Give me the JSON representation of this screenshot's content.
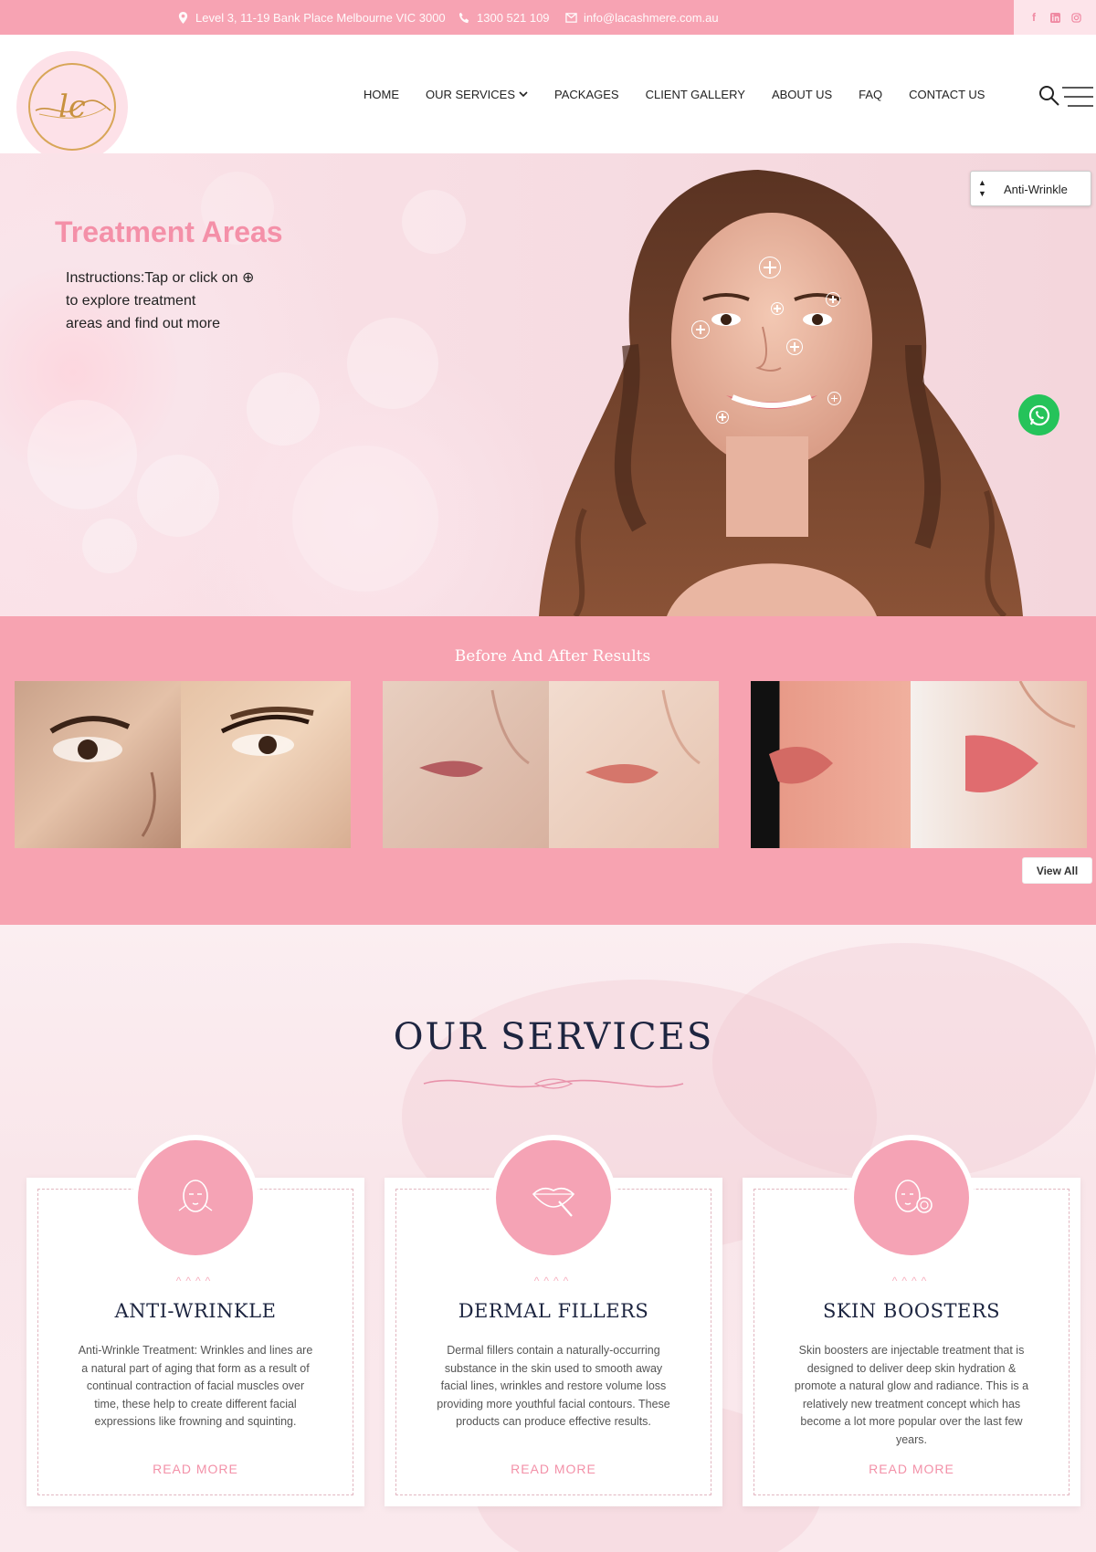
{
  "topbar": {
    "address": "Level 3, 11-19 Bank Place Melbourne VIC 3000",
    "phone": "1300 521 109",
    "email": "info@lacashmere.com.au",
    "social": [
      "facebook-icon",
      "linkedin-icon",
      "instagram-icon"
    ]
  },
  "header": {
    "logo_monogram": "lc",
    "nav": [
      "HOME",
      "OUR SERVICES",
      "PACKAGES",
      "CLIENT GALLERY",
      "ABOUT US",
      "FAQ",
      "CONTACT US"
    ]
  },
  "hero": {
    "title": "Treatment Areas",
    "instructions": [
      "Instructions:Tap or click on ⊕",
      "to explore treatment",
      "areas and find out more"
    ],
    "select_value": "Anti-Wrinkle"
  },
  "before_after": {
    "title": "Before And After Results",
    "view_all": "View All"
  },
  "services": {
    "title": "OUR SERVICES",
    "cards": [
      {
        "title": "ANTI-WRINKLE",
        "text": "Anti-Wrinkle Treatment: Wrinkles and lines are a natural part of aging that form as a result of continual contraction of facial muscles over time, these help to create different facial expressions like frowning and squinting.",
        "read_more": "READ MORE",
        "icon": "face-icon"
      },
      {
        "title": "DERMAL FILLERS",
        "text": "Dermal fillers contain a naturally-occurring substance in the skin used to smooth away facial lines, wrinkles and restore volume loss providing more youthful facial contours. These products can produce effective results.",
        "read_more": "READ MORE",
        "icon": "lips-syringe-icon"
      },
      {
        "title": "SKIN BOOSTERS",
        "text": "Skin boosters are injectable treatment that is designed to deliver deep skin hydration & promote a natural glow and radiance. This is a relatively new treatment concept which has become a lot more popular over the last few years.",
        "read_more": "READ MORE",
        "icon": "face-serum-icon"
      }
    ]
  },
  "colors": {
    "brand_pink": "#f7a3b3",
    "title_pink": "#f490a8",
    "navy": "#1d2540",
    "whatsapp": "#25c35a"
  }
}
